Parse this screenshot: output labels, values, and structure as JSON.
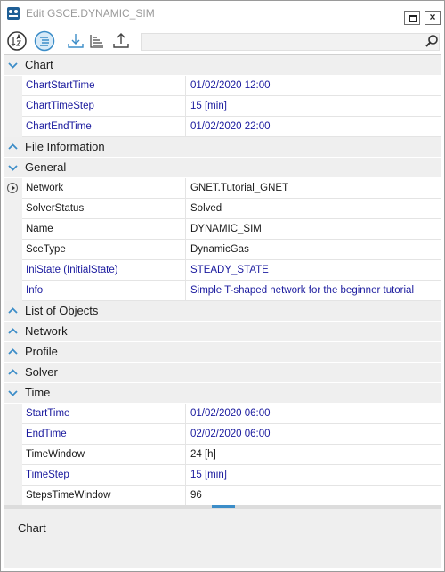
{
  "window": {
    "title": "Edit GSCE.DYNAMIC_SIM",
    "restore_label": "",
    "close_label": "×"
  },
  "toolbar": {
    "search": {
      "value": "",
      "placeholder": ""
    }
  },
  "sections": [
    {
      "label": "Chart",
      "expanded": true,
      "rows": [
        {
          "name": "ChartStartTime",
          "value": "01/02/2020 12:00",
          "blue": true
        },
        {
          "name": "ChartTimeStep",
          "value": "15 [min]",
          "blue": true
        },
        {
          "name": "ChartEndTime",
          "value": "01/02/2020 22:00",
          "blue": true
        }
      ]
    },
    {
      "label": "File Information",
      "expanded": false,
      "rows": []
    },
    {
      "label": "General",
      "expanded": true,
      "rows": [
        {
          "name": "Network",
          "value": "GNET.Tutorial_GNET",
          "blue": false,
          "arrow": true
        },
        {
          "name": "SolverStatus",
          "value": "Solved",
          "blue": false
        },
        {
          "name": "Name",
          "value": "DYNAMIC_SIM",
          "blue": false
        },
        {
          "name": "SceType",
          "value": "DynamicGas",
          "blue": false
        },
        {
          "name": "IniState (InitialState)",
          "value": "STEADY_STATE",
          "blue": true
        },
        {
          "name": "Info",
          "value": "Simple T-shaped network for the beginner tutorial",
          "blue": true
        }
      ]
    },
    {
      "label": "List of Objects",
      "expanded": false,
      "rows": []
    },
    {
      "label": "Network",
      "expanded": false,
      "rows": []
    },
    {
      "label": "Profile",
      "expanded": false,
      "rows": []
    },
    {
      "label": "Solver",
      "expanded": false,
      "rows": []
    },
    {
      "label": "Time",
      "expanded": true,
      "rows": [
        {
          "name": "StartTime",
          "value": "01/02/2020 06:00",
          "blue": true
        },
        {
          "name": "EndTime",
          "value": "02/02/2020 06:00",
          "blue": true
        },
        {
          "name": "TimeWindow",
          "value": "24 [h]",
          "blue": false
        },
        {
          "name": "TimeStep",
          "value": "15 [min]",
          "blue": true
        },
        {
          "name": "StepsTimeWindow",
          "value": "96",
          "blue": false
        }
      ]
    }
  ],
  "description": {
    "title": "Chart"
  },
  "colors": {
    "accent": "#3c8dc8",
    "modified_text": "#1a1a9e",
    "category_bg": "#efefef"
  }
}
